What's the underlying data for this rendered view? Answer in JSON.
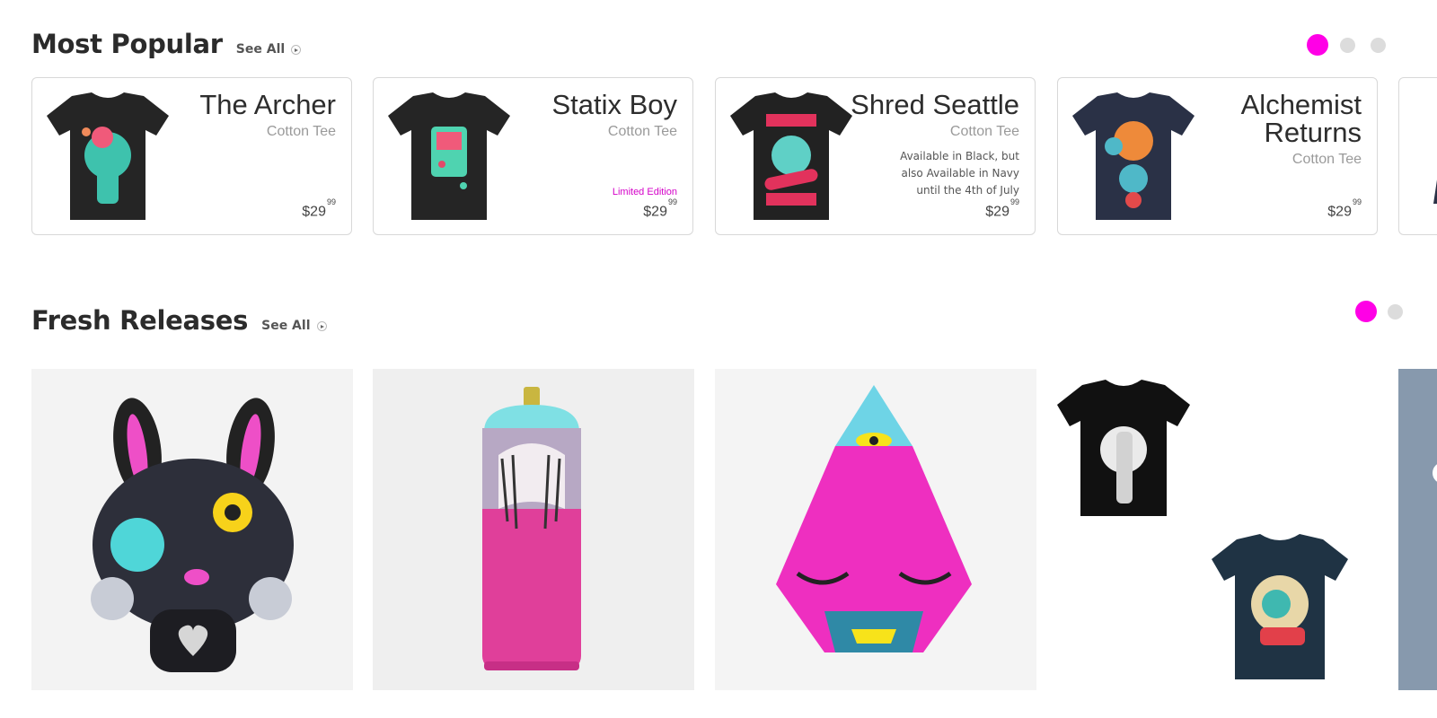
{
  "popular": {
    "title": "Most Popular",
    "see_all": "See All",
    "products": [
      {
        "name": "The Archer",
        "type": "Cotton Tee",
        "price": "$29",
        "cents": "99",
        "shirt_color": "#252525",
        "art_color": "#3ec2ad"
      },
      {
        "name": "Statix Boy",
        "type": "Cotton Tee",
        "badge": "Limited Edition",
        "price": "$29",
        "cents": "99",
        "shirt_color": "#252525",
        "art_color": "#4fd3b0"
      },
      {
        "name": "Shred Seattle",
        "type": "Cotton Tee",
        "description": "Available in Black, but also Available in Navy until the 4th of July",
        "price": "$29",
        "cents": "99",
        "shirt_color": "#222222",
        "art_color": "#e2325c"
      },
      {
        "name": "Alchemist Returns",
        "type": "Cotton Tee",
        "price": "$29",
        "cents": "99",
        "shirt_color": "#2a3146",
        "art_color": "#ee8a3a"
      }
    ]
  },
  "fresh": {
    "title": "Fresh Releases",
    "see_all": "See All",
    "items": [
      {
        "label": "bunny-vinyl-toy",
        "accent": "#ee4fc7"
      },
      {
        "label": "painted-spray-can",
        "accent": "#e03f9a"
      },
      {
        "label": "pink-pyramid-sculpture",
        "accent": "#ee2fc0"
      },
      {
        "label": "tee-duo",
        "accent": "#1f3344"
      }
    ]
  },
  "colors": {
    "accent": "#ff00e6",
    "dot_inactive": "#dcdcdc"
  }
}
